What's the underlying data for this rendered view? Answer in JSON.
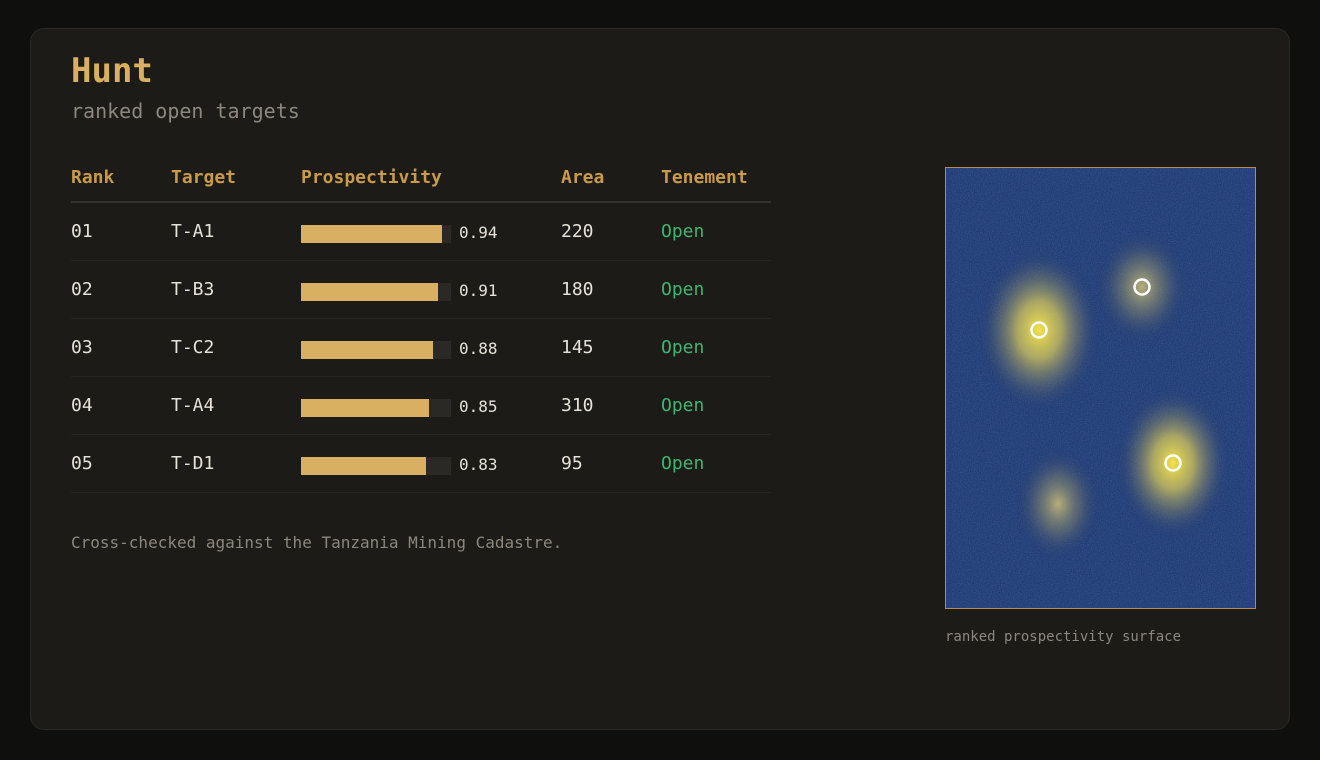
{
  "header": {
    "title": "Hunt",
    "subtitle": "ranked open targets"
  },
  "table": {
    "columns": [
      "Rank",
      "Target",
      "Prospectivity",
      "Area",
      "Tenement"
    ],
    "rows": [
      {
        "rank": "01",
        "target": "T-A1",
        "prospectivity": 0.94,
        "prospectivity_label": "0.94",
        "area": "220",
        "tenement": "Open"
      },
      {
        "rank": "02",
        "target": "T-B3",
        "prospectivity": 0.91,
        "prospectivity_label": "0.91",
        "area": "180",
        "tenement": "Open"
      },
      {
        "rank": "03",
        "target": "T-C2",
        "prospectivity": 0.88,
        "prospectivity_label": "0.88",
        "area": "145",
        "tenement": "Open"
      },
      {
        "rank": "04",
        "target": "T-A4",
        "prospectivity": 0.85,
        "prospectivity_label": "0.85",
        "area": "310",
        "tenement": "Open"
      },
      {
        "rank": "05",
        "target": "T-D1",
        "prospectivity": 0.83,
        "prospectivity_label": "0.83",
        "area": "95",
        "tenement": "Open"
      }
    ]
  },
  "footer": {
    "note": "Cross-checked against the Tanzania Mining Cadastre."
  },
  "map": {
    "caption": "ranked prospectivity surface"
  },
  "colors": {
    "accent": "#d9b061",
    "header": "#c99a4a",
    "open_status": "#3fb56f",
    "map_background": "#13306a"
  }
}
